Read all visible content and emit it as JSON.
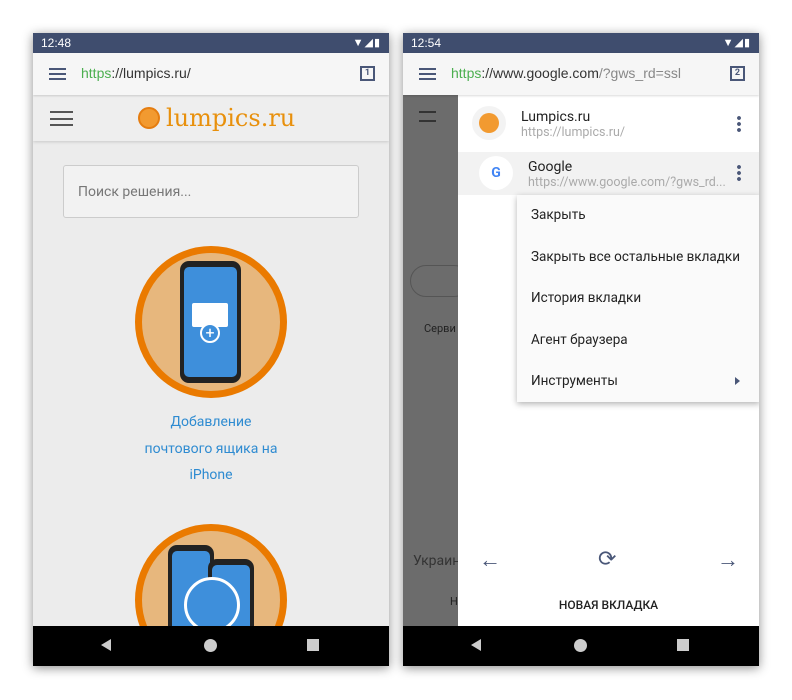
{
  "left": {
    "status_time": "12:48",
    "url_scheme": "https",
    "url_rest": "://lumpics.ru/",
    "tab_count": "1",
    "logo_text": "lumpics.ru",
    "search_placeholder": "Поиск решения...",
    "article_lines": [
      "Добавление",
      "почтового ящика на",
      "iPhone"
    ]
  },
  "right": {
    "status_time": "12:54",
    "url_scheme": "https",
    "url_host": "://www.google.com",
    "url_path": "/?gws_rd=ssl",
    "tab_count": "2",
    "background_text": {
      "services": "Серви",
      "country": "Украин",
      "bottom": "Н"
    },
    "tabs": [
      {
        "title": "Lumpics.ru",
        "url": "https://lumpics.ru/"
      },
      {
        "title": "Google",
        "url": "https://www.google.com/?gws_rd..."
      }
    ],
    "menu": [
      "Закрыть",
      "Закрыть все остальные вкладки",
      "История вкладки",
      "Агент браузера",
      "Инструменты"
    ],
    "new_tab_label": "НОВАЯ ВКЛАДКА"
  },
  "colors": {
    "status_bar": "#3f4d6e",
    "https": "#4caf50",
    "brand_orange": "#e8900c",
    "link": "#2e8bd1"
  }
}
